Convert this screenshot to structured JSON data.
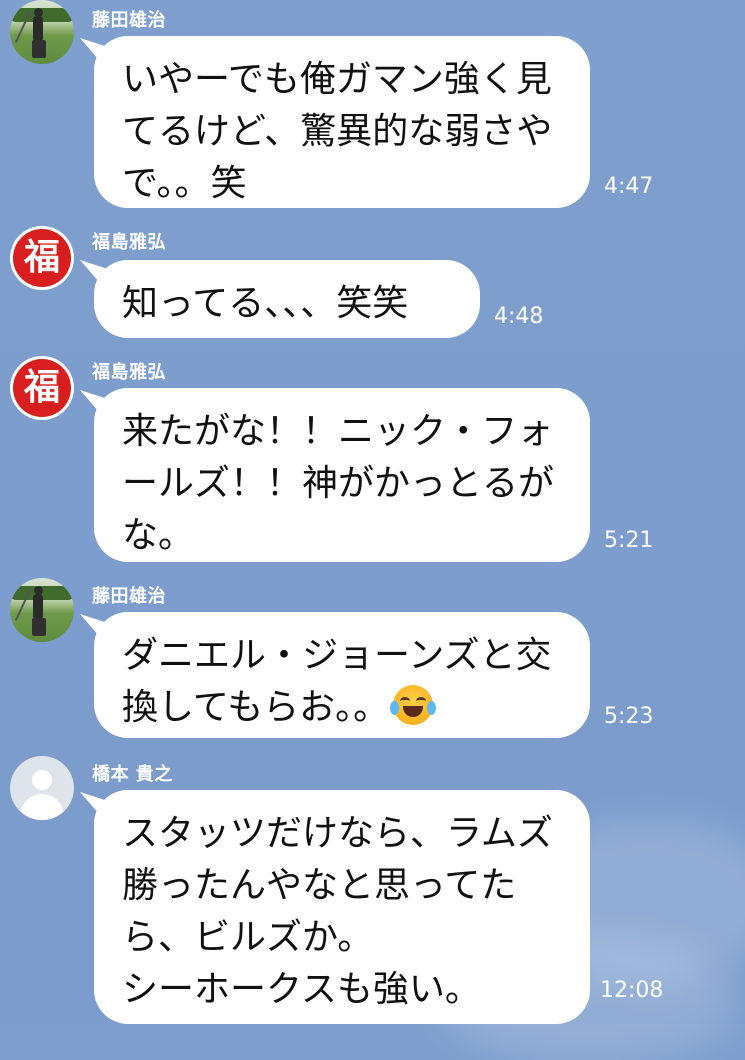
{
  "messages": [
    {
      "sender": "藤田雄治",
      "avatar": "golfer-photo",
      "lines": [
        "いやーでも俺ガマン強く見",
        "てるけど、驚異的な弱さや",
        "で。。笑"
      ],
      "time": "4:47"
    },
    {
      "sender": "福島雅弘",
      "avatar": "fuku-logo",
      "lines": [
        "知ってる、、、笑笑"
      ],
      "time": "4:48"
    },
    {
      "sender": "福島雅弘",
      "avatar": "fuku-logo",
      "lines": [
        "来たがな！！ニック・フォ",
        "ールズ！！神がかっとるが",
        "な。"
      ],
      "time": "5:21"
    },
    {
      "sender": "藤田雄治",
      "avatar": "golfer-photo",
      "lines": [
        "ダニエル・ジョーンズと交",
        "換してもらお。。"
      ],
      "emoji": "face-with-tears-of-joy",
      "time": "5:23"
    },
    {
      "sender": "橋本 貴之",
      "avatar": "default-user-icon",
      "lines": [
        "スタッツだけなら、ラムズ",
        "勝ったんやなと思ってた",
        "ら、ビルズか。",
        "シーホークスも強い。"
      ],
      "time": "12:08"
    }
  ],
  "fuku_glyph": "福",
  "colors": {
    "background": "#7f9fce",
    "bubble": "#ffffff",
    "fuku_red": "#d81e1e"
  }
}
